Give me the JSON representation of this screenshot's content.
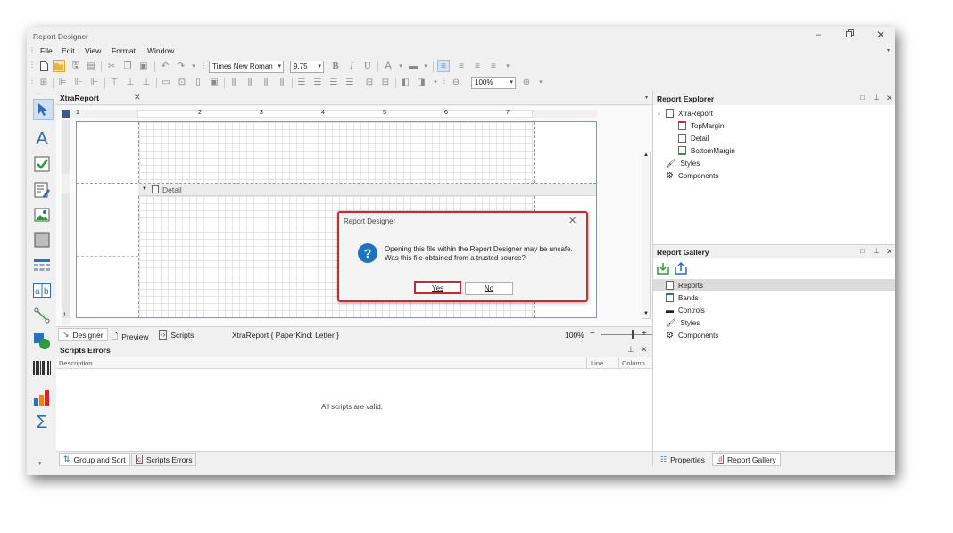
{
  "window": {
    "title": "Report Designer"
  },
  "menu": [
    "File",
    "Edit",
    "View",
    "Format",
    "Window"
  ],
  "toolbar": {
    "font_name": "Times New Roman",
    "font_size": "9.75",
    "zoom": "100%"
  },
  "document_tab": {
    "label": "XtraReport"
  },
  "ruler": {
    "labels": [
      "1",
      "2",
      "3",
      "4",
      "5",
      "6",
      "7"
    ]
  },
  "band": {
    "detail_label": "Detail"
  },
  "dialog": {
    "title": "Report Designer",
    "line1": "Opening this file within the Report Designer may be unsafe.",
    "line2": "Was this file obtained from a trusted source?",
    "yes_label": "Yes",
    "no_label": "No"
  },
  "view_tabs": {
    "designer": "Designer",
    "preview": "Preview",
    "scripts": "Scripts",
    "status": "XtraReport { PaperKind: Letter }"
  },
  "zoom_bar": {
    "value": "100%",
    "minus": "−",
    "plus": "+"
  },
  "scripts_errors": {
    "title": "Scripts Errors",
    "col_description": "Description",
    "col_line": "Line",
    "col_column": "Column",
    "message": "All scripts are valid."
  },
  "bottom_tabs": {
    "group_sort": "Group and Sort",
    "scripts_errors": "Scripts Errors"
  },
  "report_explorer": {
    "title": "Report Explorer",
    "root": "XtraReport",
    "items": [
      "TopMargin",
      "Detail",
      "BottomMargin"
    ],
    "styles": "Styles",
    "components": "Components"
  },
  "report_gallery": {
    "title": "Report Gallery",
    "items": [
      "Reports",
      "Bands",
      "Controls",
      "Styles",
      "Components"
    ]
  },
  "right_bottom_tabs": {
    "properties": "Properties",
    "report_gallery": "Report Gallery"
  },
  "colors": {
    "accent_blue": "#1e73be",
    "dialog_border": "#d0262d",
    "selected_row": "#dcdcdc",
    "green": "#2e9a3a",
    "orange": "#ee7f1a"
  }
}
